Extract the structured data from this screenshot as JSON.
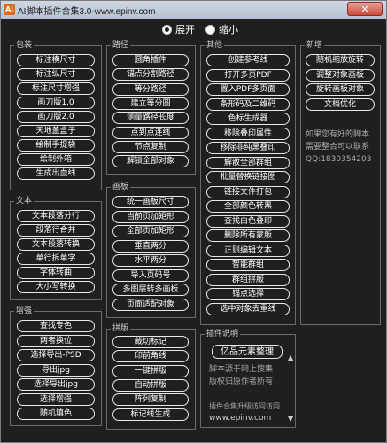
{
  "window": {
    "title": "AI脚本插件合集3.0-www.epinv.com",
    "close_label": "✕"
  },
  "view_mode": {
    "expand_label": "展开",
    "shrink_label": "缩小"
  },
  "groups": {
    "package": {
      "title": "包装",
      "buttons": [
        "标注横尺寸",
        "标注纵尺寸",
        "标注尺寸增强",
        "画刀版1.0",
        "画刀版2.0",
        "天地盖盒子",
        "绘制手提袋",
        "绘制外箱",
        "生成出血线"
      ]
    },
    "text": {
      "title": "文本",
      "buttons": [
        "文本段落分行",
        "段落行合并",
        "文本段落转换",
        "单行拆单字",
        "字体转曲",
        "大小写转换"
      ]
    },
    "enhance": {
      "title": "增强",
      "buttons": [
        "查找专色",
        "两者换位",
        "选择导出-PSD",
        "导出jpg",
        "选择导出jpg",
        "选择增强",
        "随机填色"
      ]
    },
    "path": {
      "title": "路径",
      "buttons": [
        "圆角插件",
        "锚点分割路径",
        "等分路径",
        "建立等分圆",
        "测量路径长度",
        "点到点连线",
        "节点复制",
        "解锁全部对象"
      ]
    },
    "artboard": {
      "title": "画板",
      "buttons": [
        "统一画板尺寸",
        "当前页加矩形",
        "全部页加矩形",
        "垂直两分",
        "水平两分",
        "导入页码号",
        "多图层转多画板",
        "页面适配对象"
      ]
    },
    "imposition": {
      "title": "拼版",
      "buttons": [
        "裁切标记",
        "印前角线",
        "一键拼版",
        "自动拼版",
        "阵列复制",
        "标记线生成"
      ]
    },
    "other": {
      "title": "其他",
      "buttons": [
        "创建参考线",
        "打开多页PDF",
        "置入PDF多页面",
        "条形码及二维码",
        "色标生成器",
        "移除叠印属性",
        "移除非纯黑叠印",
        "解散全部群组",
        "批量替换链接图",
        "链接文件打包",
        "全部颜色转黑",
        "查找白色叠印",
        "删除所有蒙版",
        "正则编辑文本",
        "智能群组",
        "群组拼版",
        "锚点选择",
        "选中对象去重线"
      ]
    },
    "new": {
      "title": "新增",
      "buttons": [
        "随机缩放旋转",
        "调整对象画板",
        "旋转画板对象",
        "文档优化"
      ],
      "info": [
        "如果您有好的脚本",
        "需要整合可以联系",
        "QQ:1830354203"
      ]
    },
    "plugin_info": {
      "title": "插件说明",
      "main_button": "亿品元素整理",
      "lines": [
        "脚本源于网上搜集",
        "版权归原作者所有",
        "",
        "插件合集升级访问访问",
        "www.epinv.com"
      ],
      "footer_url": "www.epinv.com"
    }
  }
}
